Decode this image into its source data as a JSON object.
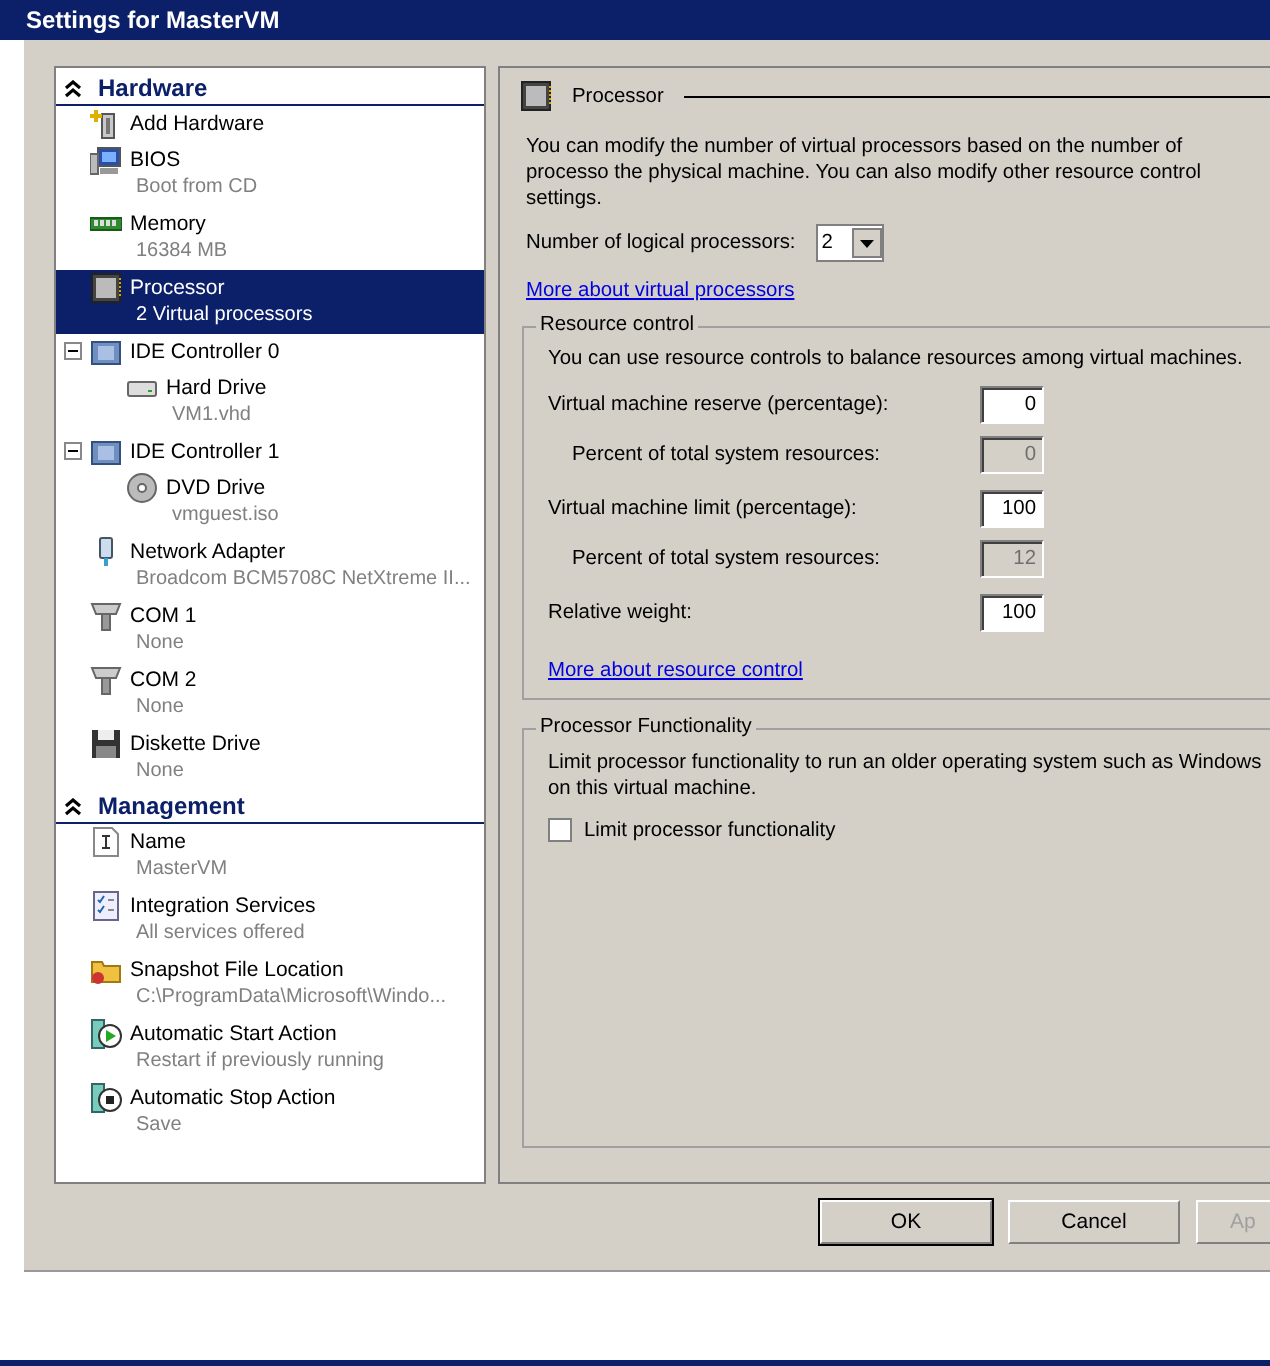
{
  "window": {
    "title": "Settings for MasterVM"
  },
  "sidebar": {
    "sections": [
      {
        "title": "Hardware",
        "expanded": true,
        "items": [
          {
            "name": "Add Hardware",
            "selected": false
          },
          {
            "name": "BIOS",
            "detail": "Boot from CD",
            "selected": false
          },
          {
            "name": "Memory",
            "detail": "16384 MB",
            "selected": false
          },
          {
            "name": "Processor",
            "detail": "2 Virtual processors",
            "selected": true
          },
          {
            "name": "IDE Controller 0",
            "selected": false,
            "expanded": true,
            "children": [
              {
                "name": "Hard Drive",
                "detail": "VM1.vhd",
                "selected": false
              }
            ]
          },
          {
            "name": "IDE Controller 1",
            "selected": false,
            "expanded": true,
            "children": [
              {
                "name": "DVD Drive",
                "detail": "vmguest.iso",
                "selected": false
              }
            ]
          },
          {
            "name": "Network Adapter",
            "detail": "Broadcom BCM5708C NetXtreme II...",
            "selected": false
          },
          {
            "name": "COM 1",
            "detail": "None",
            "selected": false
          },
          {
            "name": "COM 2",
            "detail": "None",
            "selected": false
          },
          {
            "name": "Diskette Drive",
            "detail": "None",
            "selected": false
          }
        ]
      },
      {
        "title": "Management",
        "expanded": true,
        "items": [
          {
            "name": "Name",
            "detail": "MasterVM",
            "selected": false
          },
          {
            "name": "Integration Services",
            "detail": "All services offered",
            "selected": false
          },
          {
            "name": "Snapshot File Location",
            "detail": "C:\\ProgramData\\Microsoft\\Windo...",
            "selected": false
          },
          {
            "name": "Automatic Start Action",
            "detail": "Restart if previously running",
            "selected": false
          },
          {
            "name": "Automatic Stop Action",
            "detail": "Save",
            "selected": false
          }
        ]
      }
    ]
  },
  "panel": {
    "title": "Processor",
    "description": "You can modify the number of virtual processors based on the number of processo the physical machine. You can also modify other resource control settings.",
    "processors": {
      "label": "Number of logical processors:",
      "value": "2"
    },
    "link": "More about virtual processors",
    "resource_control": {
      "title": "Resource control",
      "description": "You can use resource controls to balance resources among virtual machines.",
      "rows": [
        {
          "label": "Virtual machine reserve (percentage):",
          "value": "0",
          "disabled": false,
          "sub": false
        },
        {
          "label": "Percent of total system resources:",
          "value": "0",
          "disabled": true,
          "sub": true
        },
        {
          "label": "Virtual machine limit (percentage):",
          "value": "100",
          "disabled": false,
          "sub": false
        },
        {
          "label": "Percent of total system resources:",
          "value": "12",
          "disabled": true,
          "sub": true
        },
        {
          "label": "Relative weight:",
          "value": "100",
          "disabled": false,
          "sub": false
        }
      ],
      "link": "More about resource control"
    },
    "functionality": {
      "title": "Processor Functionality",
      "description": "Limit processor functionality to run an older operating system such as Windows on this virtual machine.",
      "checkbox": {
        "label": "Limit processor functionality",
        "checked": false
      }
    }
  },
  "buttons": [
    {
      "label": "OK",
      "default": true,
      "disabled": false
    },
    {
      "label": "Cancel",
      "default": false,
      "disabled": false
    },
    {
      "label": "Ap",
      "default": false,
      "disabled": true
    }
  ]
}
